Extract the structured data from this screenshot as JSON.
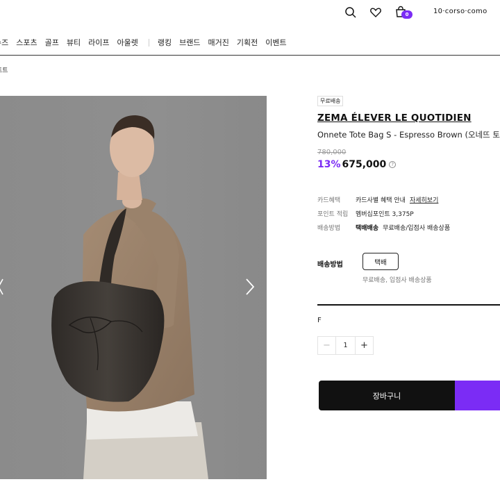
{
  "header": {
    "logo_text": "10·corso·como",
    "cart_count": "0",
    "brand_color": "#7b2cf5"
  },
  "nav": {
    "items": [
      "슈즈",
      "스포츠",
      "골프",
      "뷰티",
      "라이프",
      "아울렛"
    ],
    "items2": [
      "랭킹",
      "브랜드",
      "매거진",
      "기획전",
      "이벤트"
    ]
  },
  "breadcrumb": "토트",
  "product": {
    "ship_tag": "무료배송",
    "brand": "ZEMA ÉLEVER LE QUOTIDIEN",
    "name": "Onnete Tote Bag S - Espresso Brown (오네뜨 토트",
    "original_price": "780,000",
    "discount": "13%",
    "price": "675,000",
    "help_icon": "?"
  },
  "info_rows": {
    "card": {
      "label": "카드혜택",
      "value": "카드사별 혜택 안내",
      "link": "자세히보기"
    },
    "points": {
      "label": "포인트 적립",
      "value": "멤버십포인트 3,375P"
    },
    "shipping": {
      "label": "배송방법",
      "bold": "택배배송",
      "value": "무료배송/입점사 배송상품"
    }
  },
  "shipping_select": {
    "label": "배송방법",
    "option": "택배",
    "note": "무료배송, 입점사 배송상품"
  },
  "option": {
    "label": "F",
    "quantity": "1",
    "minus": "−",
    "plus": "+"
  },
  "actions": {
    "cart_label": "장바구니"
  }
}
